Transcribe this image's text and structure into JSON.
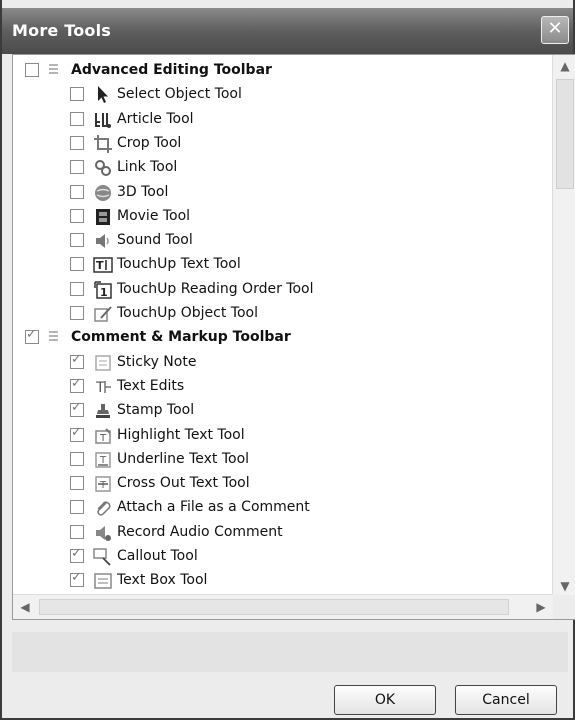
{
  "dialog": {
    "title": "More Tools",
    "ok_label": "OK",
    "cancel_label": "Cancel"
  },
  "toolbars": [
    {
      "name": "Advanced Editing Toolbar",
      "checked": false,
      "items": [
        {
          "label": "Select Object Tool",
          "checked": false,
          "icon": "cursor-arrow-icon"
        },
        {
          "label": "Article Tool",
          "checked": false,
          "icon": "article-icon"
        },
        {
          "label": "Crop Tool",
          "checked": false,
          "icon": "crop-icon"
        },
        {
          "label": "Link Tool",
          "checked": false,
          "icon": "link-icon"
        },
        {
          "label": "3D Tool",
          "checked": false,
          "icon": "3d-icon"
        },
        {
          "label": "Movie Tool",
          "checked": false,
          "icon": "film-icon"
        },
        {
          "label": "Sound Tool",
          "checked": false,
          "icon": "speaker-icon"
        },
        {
          "label": "TouchUp Text Tool",
          "checked": false,
          "icon": "touchup-text-icon"
        },
        {
          "label": "TouchUp Reading Order Tool",
          "checked": false,
          "icon": "reading-order-icon"
        },
        {
          "label": "TouchUp Object Tool",
          "checked": false,
          "icon": "touchup-object-icon"
        }
      ]
    },
    {
      "name": "Comment & Markup Toolbar",
      "checked": true,
      "items": [
        {
          "label": "Sticky Note",
          "checked": true,
          "icon": "sticky-note-icon"
        },
        {
          "label": "Text Edits",
          "checked": true,
          "icon": "text-edits-icon"
        },
        {
          "label": "Stamp Tool",
          "checked": true,
          "icon": "stamp-icon"
        },
        {
          "label": "Highlight Text Tool",
          "checked": true,
          "icon": "highlight-icon"
        },
        {
          "label": "Underline Text Tool",
          "checked": false,
          "icon": "underline-icon"
        },
        {
          "label": "Cross Out Text Tool",
          "checked": false,
          "icon": "cross-out-icon"
        },
        {
          "label": "Attach a File as a Comment",
          "checked": false,
          "icon": "paperclip-icon"
        },
        {
          "label": "Record Audio Comment",
          "checked": false,
          "icon": "audio-icon"
        },
        {
          "label": "Callout Tool",
          "checked": true,
          "icon": "callout-icon"
        },
        {
          "label": "Text Box Tool",
          "checked": true,
          "icon": "text-box-icon"
        }
      ]
    }
  ],
  "scrollbar": {
    "up": "▲",
    "down": "▼",
    "left": "◀",
    "right": "▶"
  }
}
